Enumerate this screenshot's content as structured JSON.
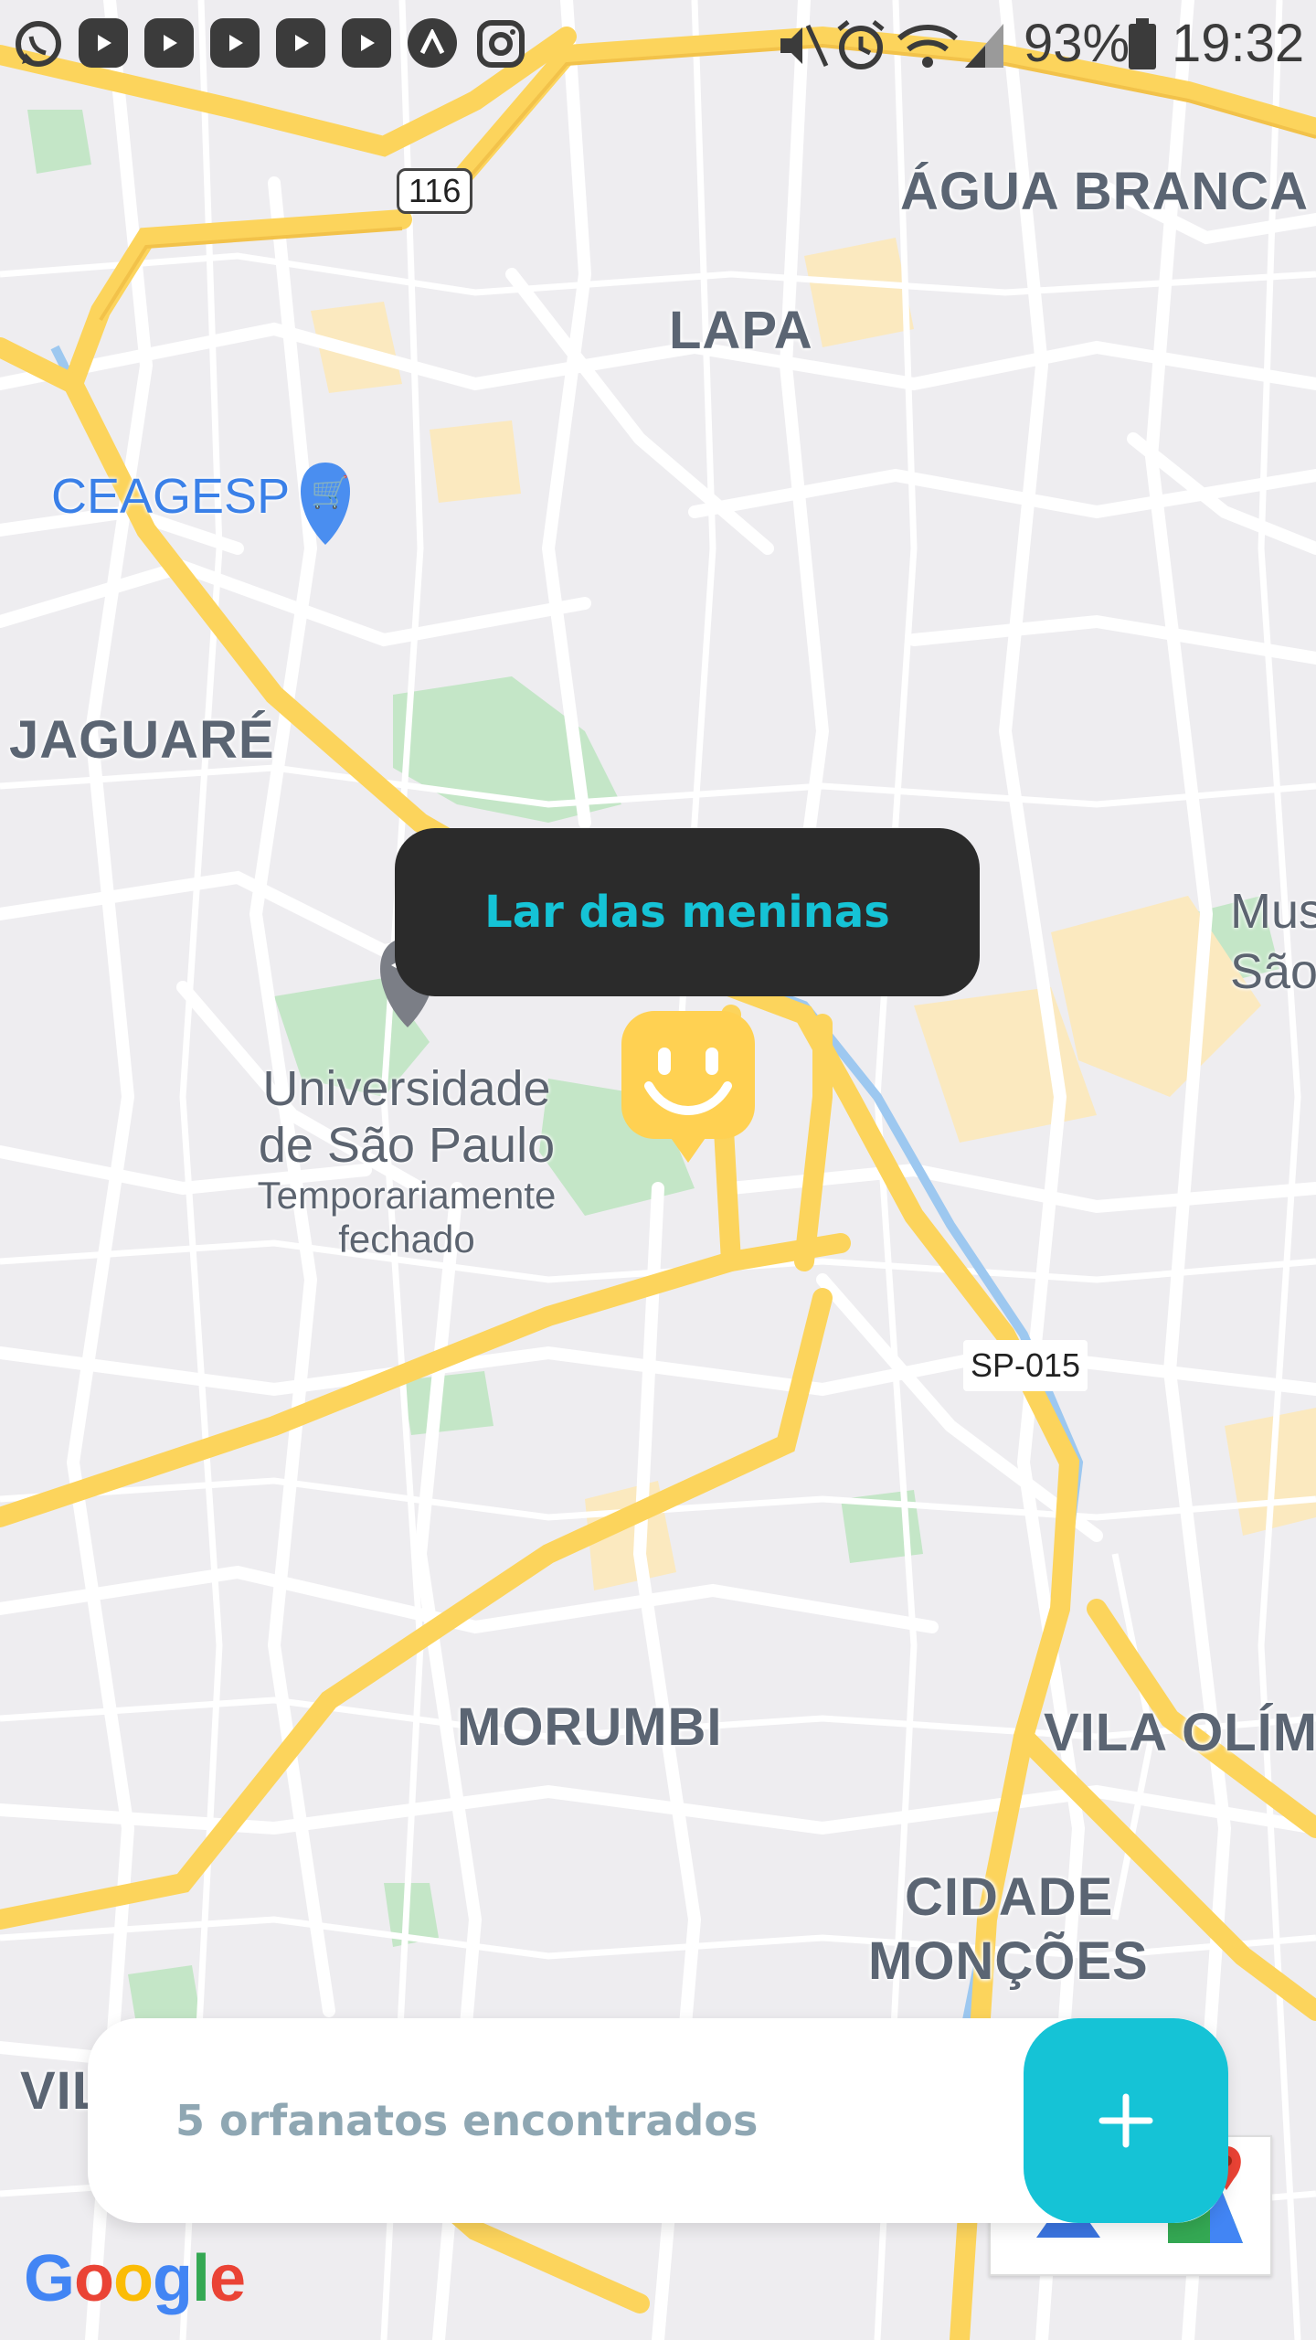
{
  "status_bar": {
    "battery": "93%",
    "time": "19:32",
    "notification_icons": [
      "whatsapp-icon",
      "youtube-icon",
      "youtube-icon",
      "youtube-icon",
      "youtube-icon",
      "youtube-icon",
      "arrow-app-icon",
      "instagram-icon"
    ],
    "system_icons": [
      "mute-icon",
      "alarm-icon",
      "wifi-icon",
      "signal-icon",
      "battery-icon"
    ]
  },
  "map": {
    "districts": [
      "ÁGUA BRANCA",
      "LAPA",
      "JAGUARÉ",
      "MORUMBI",
      "VILA OLÍMI",
      "CIDADE",
      "MONÇÕES",
      "VIL",
      "Mus",
      "São"
    ],
    "poi": {
      "ceagesp": "CEAGESP",
      "usp_line1": "Universidade",
      "usp_line2": "de São Paulo",
      "usp_status1": "Temporariamente",
      "usp_status2": "fechado"
    },
    "road_shields": [
      "116",
      "SP-015"
    ],
    "colors": {
      "background": "#eeedf0",
      "road": "#ffffff",
      "highway": "#fcd45c",
      "park": "#c4e6c7",
      "water": "#9dc8f0"
    }
  },
  "tooltip": {
    "label": "Lar das meninas"
  },
  "footer": {
    "count_text": "5 orfanatos encontrados"
  },
  "add_button": {
    "symbol": "+"
  },
  "attribution": {
    "logo": "Google"
  },
  "colors": {
    "accent": "#15c3d6",
    "marker": "#ffd152",
    "tooltip_bg": "#2b2b2b"
  }
}
